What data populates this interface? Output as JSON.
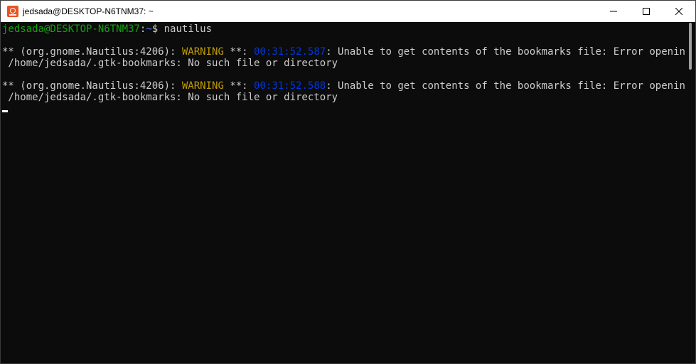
{
  "window": {
    "title": "jedsada@DESKTOP-N6TNM37: ~",
    "icon": "ubuntu-terminal-icon"
  },
  "controls": {
    "minimize": "minimize-icon",
    "maximize": "maximize-icon",
    "close": "close-icon"
  },
  "terminal": {
    "prompt_user_host": "jedsada@DESKTOP-N6TNM37",
    "prompt_colon": ":",
    "prompt_path": "~",
    "prompt_symbol": "$ ",
    "command": "nautilus",
    "messages": [
      {
        "prefix": "** (org.gnome.Nautilus:4206): ",
        "level": "WARNING",
        "sep": " **: ",
        "time": "00:31:52.587",
        "text": ": Unable to get contents of the bookmarks file: Error opening file",
        "continuation": " /home/jedsada/.gtk-bookmarks: No such file or directory"
      },
      {
        "prefix": "** (org.gnome.Nautilus:4206): ",
        "level": "WARNING",
        "sep": " **: ",
        "time": "00:31:52.588",
        "text": ": Unable to get contents of the bookmarks file: Error opening file",
        "continuation": " /home/jedsada/.gtk-bookmarks: No such file or directory"
      }
    ]
  },
  "colors": {
    "background": "#0c0c0c",
    "foreground": "#cccccc",
    "prompt_green": "#13a10e",
    "path_blue": "#3b78ff",
    "warning_yellow": "#c19c00",
    "timestamp_blue": "#0037da",
    "ubuntu_orange": "#e95420"
  }
}
